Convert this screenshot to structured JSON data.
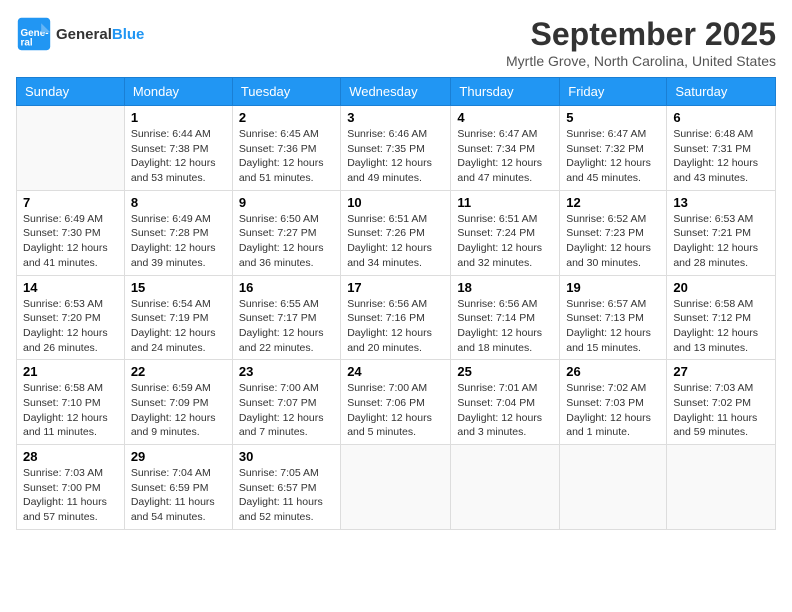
{
  "header": {
    "logo_line1": "General",
    "logo_line2": "Blue",
    "month": "September 2025",
    "location": "Myrtle Grove, North Carolina, United States"
  },
  "days_of_week": [
    "Sunday",
    "Monday",
    "Tuesday",
    "Wednesday",
    "Thursday",
    "Friday",
    "Saturday"
  ],
  "weeks": [
    [
      {
        "day": "",
        "info": ""
      },
      {
        "day": "1",
        "info": "Sunrise: 6:44 AM\nSunset: 7:38 PM\nDaylight: 12 hours\nand 53 minutes."
      },
      {
        "day": "2",
        "info": "Sunrise: 6:45 AM\nSunset: 7:36 PM\nDaylight: 12 hours\nand 51 minutes."
      },
      {
        "day": "3",
        "info": "Sunrise: 6:46 AM\nSunset: 7:35 PM\nDaylight: 12 hours\nand 49 minutes."
      },
      {
        "day": "4",
        "info": "Sunrise: 6:47 AM\nSunset: 7:34 PM\nDaylight: 12 hours\nand 47 minutes."
      },
      {
        "day": "5",
        "info": "Sunrise: 6:47 AM\nSunset: 7:32 PM\nDaylight: 12 hours\nand 45 minutes."
      },
      {
        "day": "6",
        "info": "Sunrise: 6:48 AM\nSunset: 7:31 PM\nDaylight: 12 hours\nand 43 minutes."
      }
    ],
    [
      {
        "day": "7",
        "info": "Sunrise: 6:49 AM\nSunset: 7:30 PM\nDaylight: 12 hours\nand 41 minutes."
      },
      {
        "day": "8",
        "info": "Sunrise: 6:49 AM\nSunset: 7:28 PM\nDaylight: 12 hours\nand 39 minutes."
      },
      {
        "day": "9",
        "info": "Sunrise: 6:50 AM\nSunset: 7:27 PM\nDaylight: 12 hours\nand 36 minutes."
      },
      {
        "day": "10",
        "info": "Sunrise: 6:51 AM\nSunset: 7:26 PM\nDaylight: 12 hours\nand 34 minutes."
      },
      {
        "day": "11",
        "info": "Sunrise: 6:51 AM\nSunset: 7:24 PM\nDaylight: 12 hours\nand 32 minutes."
      },
      {
        "day": "12",
        "info": "Sunrise: 6:52 AM\nSunset: 7:23 PM\nDaylight: 12 hours\nand 30 minutes."
      },
      {
        "day": "13",
        "info": "Sunrise: 6:53 AM\nSunset: 7:21 PM\nDaylight: 12 hours\nand 28 minutes."
      }
    ],
    [
      {
        "day": "14",
        "info": "Sunrise: 6:53 AM\nSunset: 7:20 PM\nDaylight: 12 hours\nand 26 minutes."
      },
      {
        "day": "15",
        "info": "Sunrise: 6:54 AM\nSunset: 7:19 PM\nDaylight: 12 hours\nand 24 minutes."
      },
      {
        "day": "16",
        "info": "Sunrise: 6:55 AM\nSunset: 7:17 PM\nDaylight: 12 hours\nand 22 minutes."
      },
      {
        "day": "17",
        "info": "Sunrise: 6:56 AM\nSunset: 7:16 PM\nDaylight: 12 hours\nand 20 minutes."
      },
      {
        "day": "18",
        "info": "Sunrise: 6:56 AM\nSunset: 7:14 PM\nDaylight: 12 hours\nand 18 minutes."
      },
      {
        "day": "19",
        "info": "Sunrise: 6:57 AM\nSunset: 7:13 PM\nDaylight: 12 hours\nand 15 minutes."
      },
      {
        "day": "20",
        "info": "Sunrise: 6:58 AM\nSunset: 7:12 PM\nDaylight: 12 hours\nand 13 minutes."
      }
    ],
    [
      {
        "day": "21",
        "info": "Sunrise: 6:58 AM\nSunset: 7:10 PM\nDaylight: 12 hours\nand 11 minutes."
      },
      {
        "day": "22",
        "info": "Sunrise: 6:59 AM\nSunset: 7:09 PM\nDaylight: 12 hours\nand 9 minutes."
      },
      {
        "day": "23",
        "info": "Sunrise: 7:00 AM\nSunset: 7:07 PM\nDaylight: 12 hours\nand 7 minutes."
      },
      {
        "day": "24",
        "info": "Sunrise: 7:00 AM\nSunset: 7:06 PM\nDaylight: 12 hours\nand 5 minutes."
      },
      {
        "day": "25",
        "info": "Sunrise: 7:01 AM\nSunset: 7:04 PM\nDaylight: 12 hours\nand 3 minutes."
      },
      {
        "day": "26",
        "info": "Sunrise: 7:02 AM\nSunset: 7:03 PM\nDaylight: 12 hours\nand 1 minute."
      },
      {
        "day": "27",
        "info": "Sunrise: 7:03 AM\nSunset: 7:02 PM\nDaylight: 11 hours\nand 59 minutes."
      }
    ],
    [
      {
        "day": "28",
        "info": "Sunrise: 7:03 AM\nSunset: 7:00 PM\nDaylight: 11 hours\nand 57 minutes."
      },
      {
        "day": "29",
        "info": "Sunrise: 7:04 AM\nSunset: 6:59 PM\nDaylight: 11 hours\nand 54 minutes."
      },
      {
        "day": "30",
        "info": "Sunrise: 7:05 AM\nSunset: 6:57 PM\nDaylight: 11 hours\nand 52 minutes."
      },
      {
        "day": "",
        "info": ""
      },
      {
        "day": "",
        "info": ""
      },
      {
        "day": "",
        "info": ""
      },
      {
        "day": "",
        "info": ""
      }
    ]
  ]
}
